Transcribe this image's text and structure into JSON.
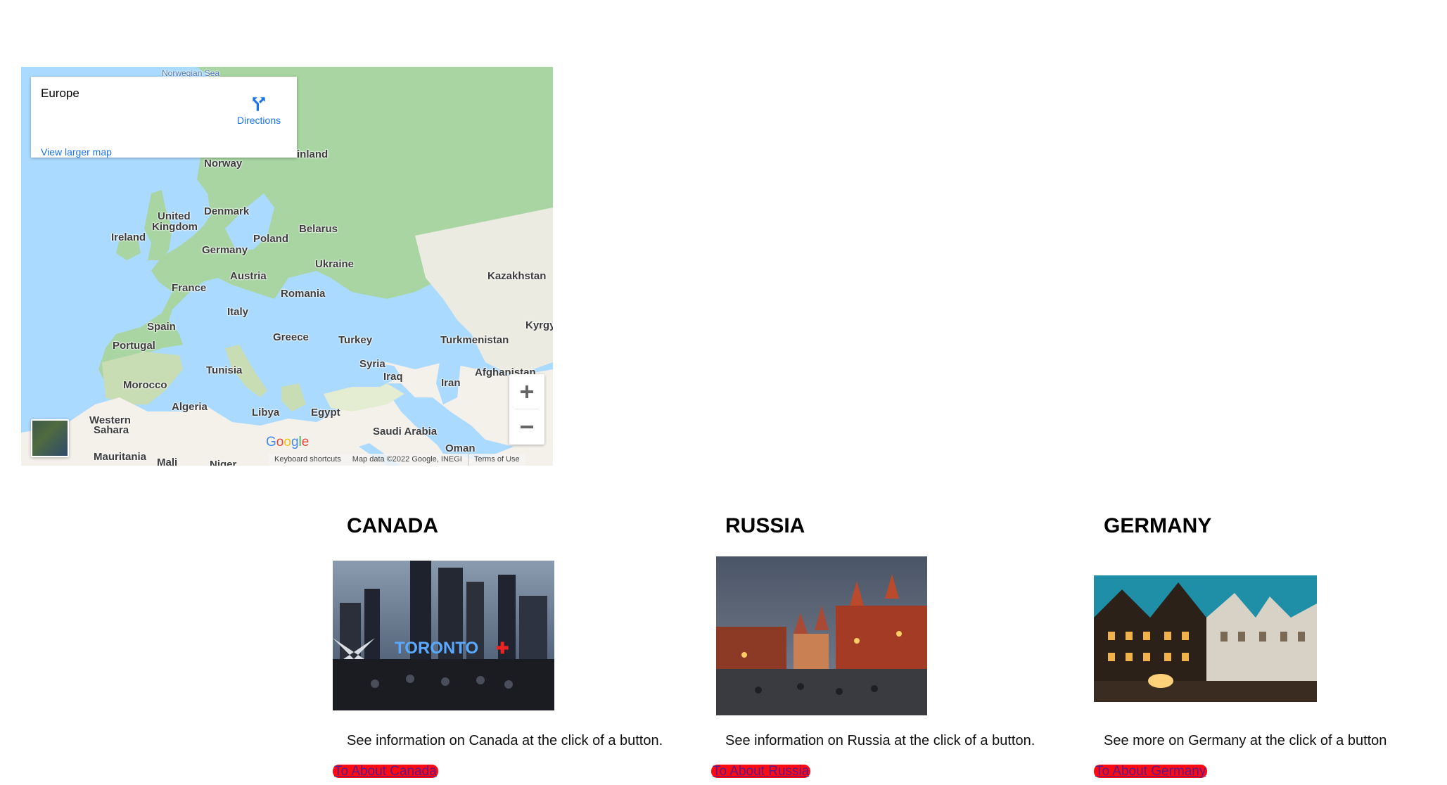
{
  "map": {
    "place_name": "Europe",
    "directions_label": "Directions",
    "view_larger_label": "View larger map",
    "zoom_in_symbol": "+",
    "zoom_out_symbol": "−",
    "google_logo_text": "Google",
    "attribution": {
      "shortcuts": "Keyboard shortcuts",
      "map_data": "Map data ©2022 Google, INEGI",
      "terms": "Terms of Use"
    },
    "labels": {
      "norwegian_sea": "Norwegian Sea",
      "finland": "inland",
      "norway": "Norway",
      "denmark": "Denmark",
      "united_kingdom_1": "United",
      "united_kingdom_2": "Kingdom",
      "ireland": "Ireland",
      "belarus": "Belarus",
      "poland": "Poland",
      "germany": "Germany",
      "ukraine": "Ukraine",
      "kazakhstan": "Kazakhstan",
      "austria": "Austria",
      "france": "France",
      "romania": "Romania",
      "italy": "Italy",
      "spain": "Spain",
      "portugal": "Portugal",
      "greece": "Greece",
      "turkey": "Turkey",
      "turkmenistan": "Turkmenistan",
      "kyrgy": "Kyrgy",
      "tunisia": "Tunisia",
      "syria": "Syria",
      "iraq": "Iraq",
      "iran": "Iran",
      "afghanistan": "Afghanistan",
      "morocco": "Morocco",
      "algeria": "Algeria",
      "libya": "Libya",
      "egypt": "Egypt",
      "western_sahara_1": "Western",
      "western_sahara_2": "Sahara",
      "saudi_arabia": "Saudi Arabia",
      "oman": "Oman",
      "mauritania": "Mauritania",
      "mali": "Mali",
      "niger": "Niger"
    },
    "colors": {
      "water": "#aadaff",
      "land_green": "#a8d5a2",
      "land_desert": "#f4f1ea",
      "link_blue": "#1a73e8"
    }
  },
  "countries": [
    {
      "title": "CANADA",
      "image_icon": "toronto-city-photo",
      "image_sign_text": "TORONTO",
      "description": "See information on Canada at the click of a button.",
      "button_label": "To About Canada"
    },
    {
      "title": "RUSSIA",
      "image_icon": "moscow-red-square-photo",
      "description": "See information on Russia at the click of a button.",
      "button_label": "To About Russia"
    },
    {
      "title": "GERMANY",
      "image_icon": "german-old-town-photo",
      "description": "See more on Germany at the click of a button",
      "button_label": "To About Germany"
    }
  ],
  "colors": {
    "button_bg": "#ff0a12",
    "button_text": "#5a1a8a"
  }
}
